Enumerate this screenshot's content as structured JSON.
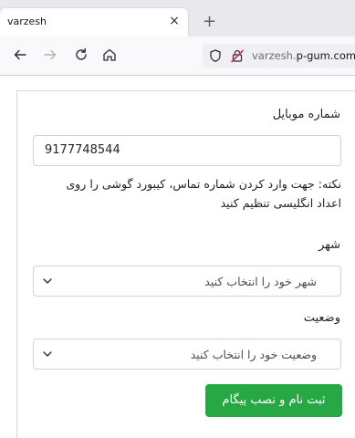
{
  "browser": {
    "tab_title": "varzesh",
    "tab_close": "×",
    "new_tab": "+",
    "url_prefix": "varzesh.",
    "url_domain": "p-gum.com"
  },
  "form": {
    "mobile_label": "شماره موبایل",
    "mobile_value": "9177748544",
    "note": "نکته: جهت وارد کردن شماره تماس، کیبورد گوشی را روی اعداد انگلیسی تنظیم کنید",
    "city_label": "شهر",
    "city_placeholder": "شهر خود را انتخاب کنید",
    "status_label": "وضعیت",
    "status_placeholder": "وضعیت خود را انتخاب کنید",
    "submit_label": "ثبت نام و نصب پیگام"
  },
  "colors": {
    "submit_bg": "#28a745"
  }
}
